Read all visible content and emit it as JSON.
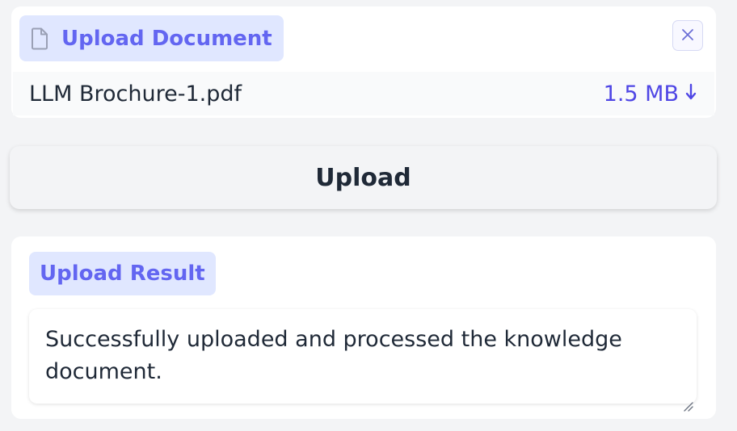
{
  "upload_panel": {
    "title": "Upload Document",
    "title_icon": "file-icon",
    "close_icon": "close-icon",
    "file": {
      "name": "LLM Brochure-1.pdf",
      "size": "1.5 MB",
      "download_icon": "download-icon"
    }
  },
  "upload_button": {
    "label": "Upload"
  },
  "result_panel": {
    "title": "Upload Result",
    "value": "Successfully uploaded and processed the knowledge document."
  },
  "colors": {
    "accent": "#6366f1",
    "badge_bg": "#e0e7ff",
    "text": "#1f2937",
    "background": "#f3f4f6"
  }
}
